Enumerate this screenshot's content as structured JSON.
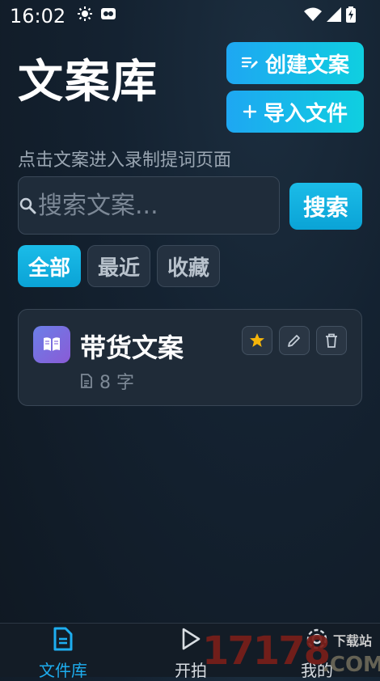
{
  "status_bar": {
    "time": "16:02"
  },
  "header": {
    "title": "文案库",
    "create_label": "创建文案",
    "import_label": "导入文件"
  },
  "hint": "点击文案进入录制提词页面",
  "search": {
    "placeholder": "搜索文案...",
    "button_label": "搜索"
  },
  "filters": [
    {
      "label": "全部",
      "active": true
    },
    {
      "label": "最近",
      "active": false
    },
    {
      "label": "收藏",
      "active": false
    }
  ],
  "scripts": [
    {
      "title": "带货文案",
      "meta": "8 字",
      "favorited": true
    }
  ],
  "bottom_nav": [
    {
      "label": "文件库",
      "active": true
    },
    {
      "label": "开拍",
      "active": false
    },
    {
      "label": "我的",
      "active": false
    }
  ],
  "watermark": {
    "digits": "17178",
    "com": ".COM",
    "text": "下载站"
  },
  "colors": {
    "accent": "#1eaef0",
    "background": "#142231",
    "star": "#f5b50a"
  }
}
